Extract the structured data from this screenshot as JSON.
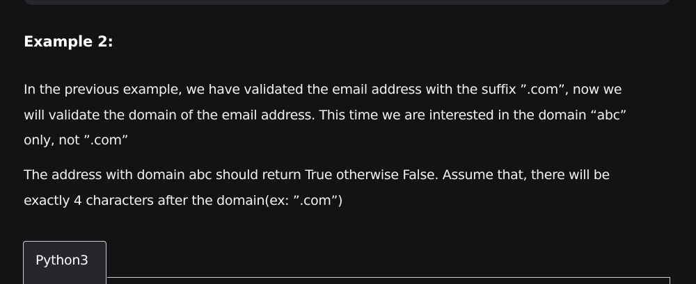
{
  "example": {
    "heading": "Example 2:",
    "paragraph1_lines": [
      "In the previous example, we have validated the email address with the suffix ”.com”, now we",
      "will validate the domain of the email address. This time we are interested in the domain “abc”",
      "only, not ”.com”"
    ],
    "paragraph2_lines": [
      "The address with domain abc should return True otherwise False. Assume that, there will be",
      "exactly 4 characters after the domain(ex: ”.com”)"
    ]
  },
  "code_tabs": {
    "active_tab_label": "Python3"
  }
}
